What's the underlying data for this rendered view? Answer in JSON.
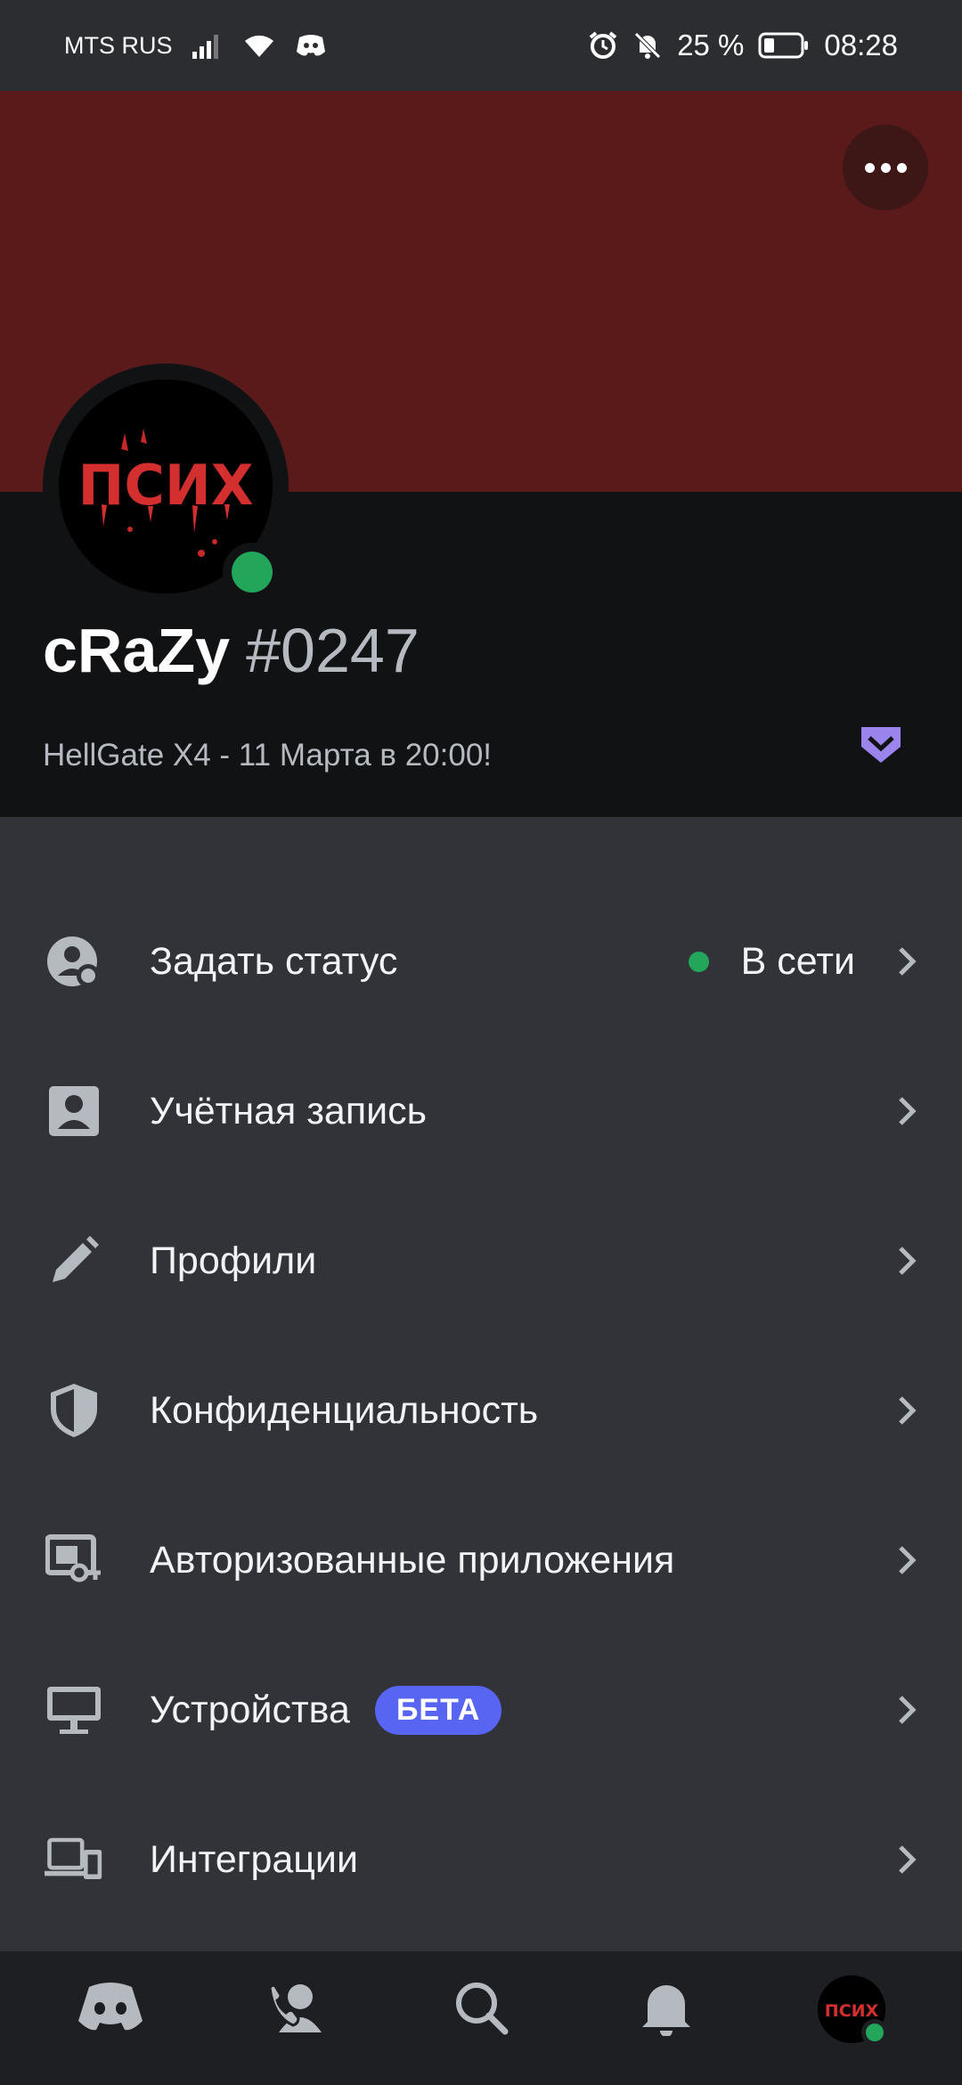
{
  "status_bar": {
    "carrier": "MTS RUS",
    "battery": "25 %",
    "time": "08:28"
  },
  "profile": {
    "username": "cRaZy",
    "discriminator": "#0247",
    "avatar_text": "ПСИХ",
    "custom_status": "HellGate X4 - 11 Марта в 20:00!",
    "presence": "online",
    "banner_color": "#5a1a1a"
  },
  "settings": {
    "items": [
      {
        "label": "Задать статус",
        "value": "В сети",
        "icon": "status-icon"
      },
      {
        "label": "Учётная запись",
        "icon": "account-icon"
      },
      {
        "label": "Профили",
        "icon": "pencil-icon"
      },
      {
        "label": "Конфиденциальность",
        "icon": "shield-icon"
      },
      {
        "label": "Авторизованные приложения",
        "icon": "authorized-apps-icon"
      },
      {
        "label": "Устройства",
        "badge": "БЕТА",
        "icon": "monitor-icon"
      },
      {
        "label": "Интеграции",
        "icon": "devices-icon"
      }
    ]
  },
  "bottom_nav": {
    "items": [
      "home-icon",
      "friends-icon",
      "search-icon",
      "bell-icon",
      "profile-avatar"
    ]
  },
  "colors": {
    "accent": "#5865f2",
    "online": "#23a55a",
    "background": "#313338",
    "header": "#111214",
    "nitro": "#9b84ec"
  }
}
